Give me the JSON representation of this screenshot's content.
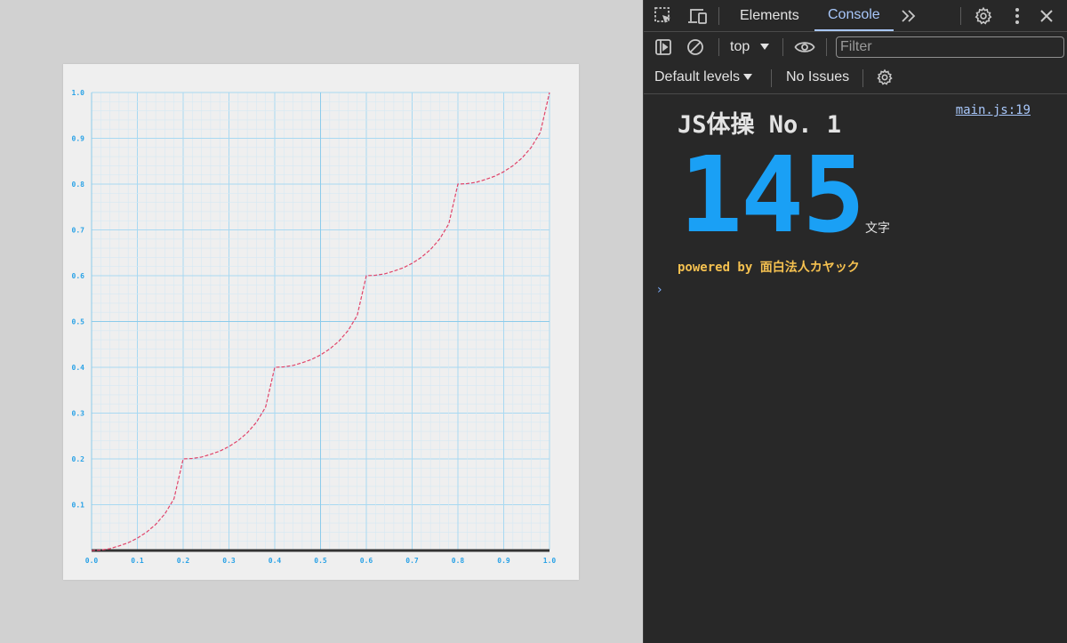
{
  "plot": {
    "chart_data": {
      "type": "line",
      "series": [
        {
          "style": "dashed",
          "color": "#e0446a",
          "x": [
            0.0,
            0.02,
            0.04,
            0.06,
            0.08,
            0.1,
            0.12,
            0.14,
            0.16,
            0.18,
            0.2,
            0.2,
            0.22,
            0.24,
            0.26,
            0.28,
            0.3,
            0.32,
            0.34,
            0.36,
            0.38,
            0.4,
            0.4,
            0.42,
            0.44,
            0.46,
            0.48,
            0.5,
            0.52,
            0.54,
            0.56,
            0.58,
            0.6,
            0.6,
            0.62,
            0.64,
            0.66,
            0.68,
            0.7,
            0.72,
            0.74,
            0.76,
            0.78,
            0.8,
            0.8,
            0.82,
            0.84,
            0.86,
            0.88,
            0.9,
            0.92,
            0.94,
            0.96,
            0.98,
            1.0
          ],
          "y": [
            0.0,
            0.001,
            0.004,
            0.01,
            0.017,
            0.027,
            0.04,
            0.057,
            0.08,
            0.113,
            0.2,
            0.2,
            0.201,
            0.204,
            0.21,
            0.217,
            0.227,
            0.24,
            0.257,
            0.28,
            0.313,
            0.4,
            0.4,
            0.401,
            0.404,
            0.41,
            0.417,
            0.427,
            0.44,
            0.457,
            0.48,
            0.513,
            0.6,
            0.6,
            0.601,
            0.604,
            0.61,
            0.617,
            0.627,
            0.64,
            0.657,
            0.68,
            0.713,
            0.8,
            0.8,
            0.801,
            0.804,
            0.81,
            0.817,
            0.827,
            0.84,
            0.857,
            0.88,
            0.913,
            1.0
          ]
        }
      ],
      "xlim": [
        0.0,
        1.0
      ],
      "ylim": [
        0.0,
        1.0
      ],
      "x_ticks": [
        "0.0",
        "0.1",
        "0.2",
        "0.3",
        "0.4",
        "0.5",
        "0.6",
        "0.7",
        "0.8",
        "0.9",
        "1.0"
      ],
      "y_ticks": [
        "0.1",
        "0.2",
        "0.3",
        "0.4",
        "0.5",
        "0.6",
        "0.7",
        "0.8",
        "0.9",
        "1.0"
      ],
      "grid": true,
      "grid_color": "#a8d9f2",
      "tick_color": "#2aa2e6",
      "baseline_color": "#333333"
    }
  },
  "devtools": {
    "tabs": [
      "Elements",
      "Console"
    ],
    "active_tab": "Console",
    "more_tabs_icon": "double-chevron-icon",
    "toolbar": {
      "context": "top",
      "filter_placeholder": "Filter"
    },
    "levels": {
      "label": "Default levels",
      "issues": "No Issues"
    },
    "console": {
      "title": "JS体操 No. 1",
      "source": "main.js:19",
      "count": "145",
      "unit": "文字",
      "powered_by": "powered by 面白法人カヤック",
      "prompt": "›"
    },
    "colors": {
      "background": "#282828",
      "active_tab": "#a8c7fa",
      "count": "#1aa0f5",
      "powered_by": "#f5c150"
    }
  }
}
